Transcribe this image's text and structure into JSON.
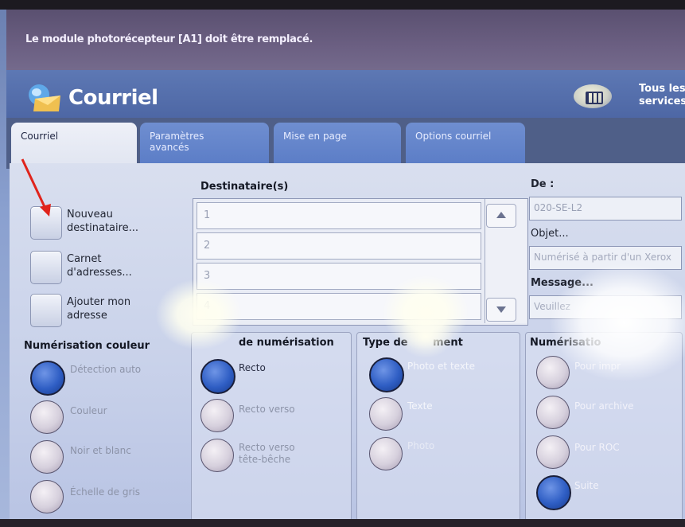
{
  "alert": {
    "message": "Le module photorécepteur [A1] doit être remplacé."
  },
  "header": {
    "title": "Courriel",
    "services_label": "Tous les services"
  },
  "tabs": [
    {
      "label": "Courriel",
      "active": true
    },
    {
      "label": "Paramètres avancés",
      "active": false
    },
    {
      "label": "Mise en page",
      "active": false
    },
    {
      "label": "Options courriel",
      "active": false
    }
  ],
  "actions": [
    {
      "label": "Nouveau destinataire..."
    },
    {
      "label": "Carnet d'adresses..."
    },
    {
      "label": "Ajouter mon adresse"
    }
  ],
  "recipients": {
    "title": "Destinataire(s)",
    "rows": [
      "1",
      "2",
      "3",
      "4"
    ]
  },
  "fields": {
    "from_label": "De :",
    "from_value": "020-SE-L2",
    "subject_label": "Objet...",
    "subject_placeholder": "Numérisé à partir d'un Xerox",
    "message_label": "Message...",
    "message_placeholder": "Veuillez"
  },
  "color_scan": {
    "title": "Numérisation couleur",
    "options": [
      {
        "label": "Détection auto",
        "selected": true
      },
      {
        "label": "Couleur",
        "selected": false
      },
      {
        "label": "Noir et blanc",
        "selected": false
      },
      {
        "label": "Échelle de gris",
        "selected": false
      }
    ]
  },
  "scan_mode": {
    "title": "de numérisation",
    "options": [
      {
        "label": "Recto",
        "selected": true
      },
      {
        "label": "Recto verso",
        "selected": false
      },
      {
        "label": "Recto verso tête-bêche",
        "selected": false
      }
    ]
  },
  "doc_type": {
    "title": "Type de",
    "title_suffix": "ment",
    "options": [
      {
        "label": "Photo et texte",
        "selected": true
      },
      {
        "label": "Texte",
        "selected": false
      },
      {
        "label": "Photo",
        "selected": false
      }
    ]
  },
  "presets": {
    "title": "Numérisatio",
    "options": [
      {
        "label": "Pour impr",
        "selected": false
      },
      {
        "label": "Pour archive",
        "selected": false
      },
      {
        "label": "Pour ROC",
        "selected": false
      },
      {
        "label": "Suite",
        "selected": true
      }
    ]
  },
  "colors": {
    "accent": "#2f5ec4",
    "alert_bg": "#6b5f82",
    "header_bg": "#4b64a2"
  }
}
